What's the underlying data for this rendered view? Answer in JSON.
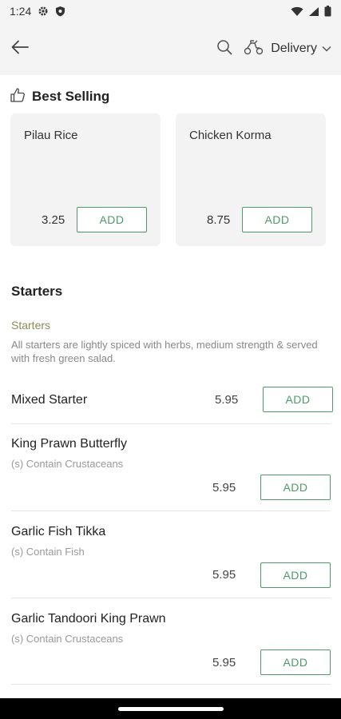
{
  "status_bar": {
    "time": "1:24",
    "icons": [
      "gear-icon",
      "shield-icon",
      "wifi-icon",
      "signal-icon",
      "battery-icon"
    ]
  },
  "app_bar": {
    "back_icon": "arrow-left-icon",
    "search_icon": "search-icon",
    "mode_icon": "delivery-scooter-icon",
    "mode_label": "Delivery",
    "dropdown_icon": "chevron-down-icon"
  },
  "best_selling": {
    "title": "Best Selling",
    "icon": "thumbs-up-icon",
    "items": [
      {
        "name": "Pilau Rice",
        "price": "3.25",
        "add_label": "ADD"
      },
      {
        "name": "Chicken Korma",
        "price": "8.75",
        "add_label": "ADD"
      }
    ]
  },
  "starters": {
    "heading": "Starters",
    "subheading": "Starters",
    "description": "All starters are lightly spiced with herbs, medium strength & served with fresh green salad.",
    "items": [
      {
        "name": "Mixed Starter",
        "note": "",
        "price": "5.95",
        "add_label": "ADD"
      },
      {
        "name": "King Prawn Butterfly",
        "note": "(s) Contain Crustaceans",
        "price": "5.95",
        "add_label": "ADD"
      },
      {
        "name": "Garlic Fish Tikka",
        "note": "(s) Contain Fish",
        "price": "5.95",
        "add_label": "ADD"
      },
      {
        "name": "Garlic Tandoori King Prawn",
        "note": "(s) Contain Crustaceans",
        "price": "5.95",
        "add_label": "ADD"
      }
    ]
  },
  "colors": {
    "accent": "#4f9a6b",
    "header_bg": "#f4f4f4",
    "card_bg": "#f3f3f3",
    "subheading": "#8a8a5a"
  }
}
